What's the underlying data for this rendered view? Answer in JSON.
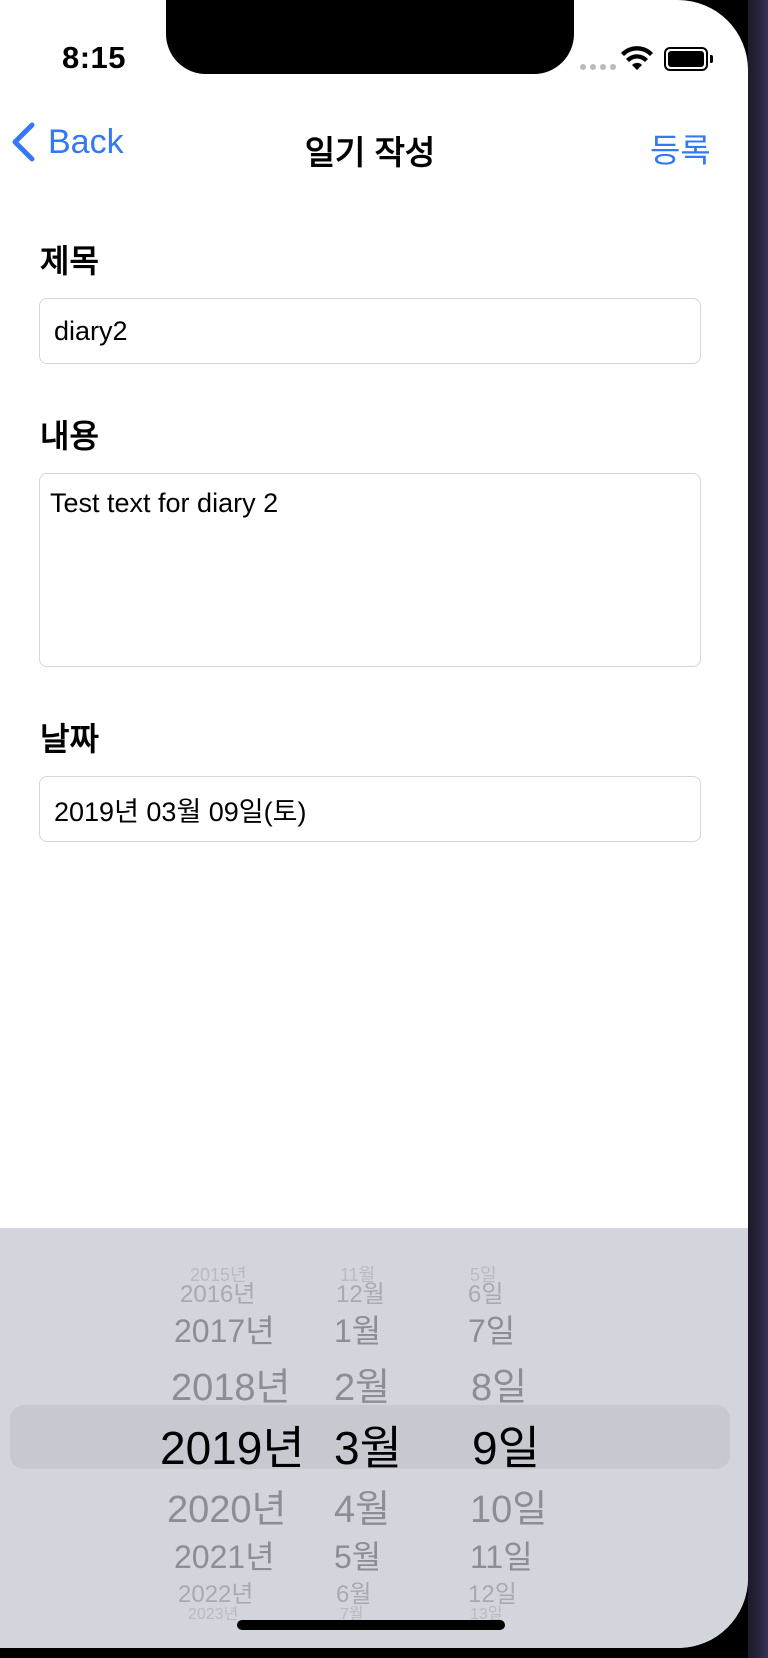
{
  "status_bar": {
    "time": "8:15"
  },
  "nav": {
    "back_label": "Back",
    "title": "일기 작성",
    "action_label": "등록"
  },
  "form": {
    "title_label": "제목",
    "title_value": "diary2",
    "content_label": "내용",
    "content_value": "Test text for diary 2",
    "date_label": "날짜",
    "date_value": "2019년 03월 09일(토)"
  },
  "picker": {
    "years": [
      "2015년",
      "2016년",
      "2017년",
      "2018년",
      "2019년",
      "2020년",
      "2021년",
      "2022년",
      "2023년"
    ],
    "months": [
      "11월",
      "12월",
      "1월",
      "2월",
      "3월",
      "4월",
      "5월",
      "6월",
      "7월"
    ],
    "days": [
      "5일",
      "6일",
      "7일",
      "8일",
      "9일",
      "10일",
      "11일",
      "12일",
      "13일"
    ],
    "selected_index": 4
  },
  "colors": {
    "accent": "#3478f6",
    "picker_bg": "#d2d5db"
  }
}
